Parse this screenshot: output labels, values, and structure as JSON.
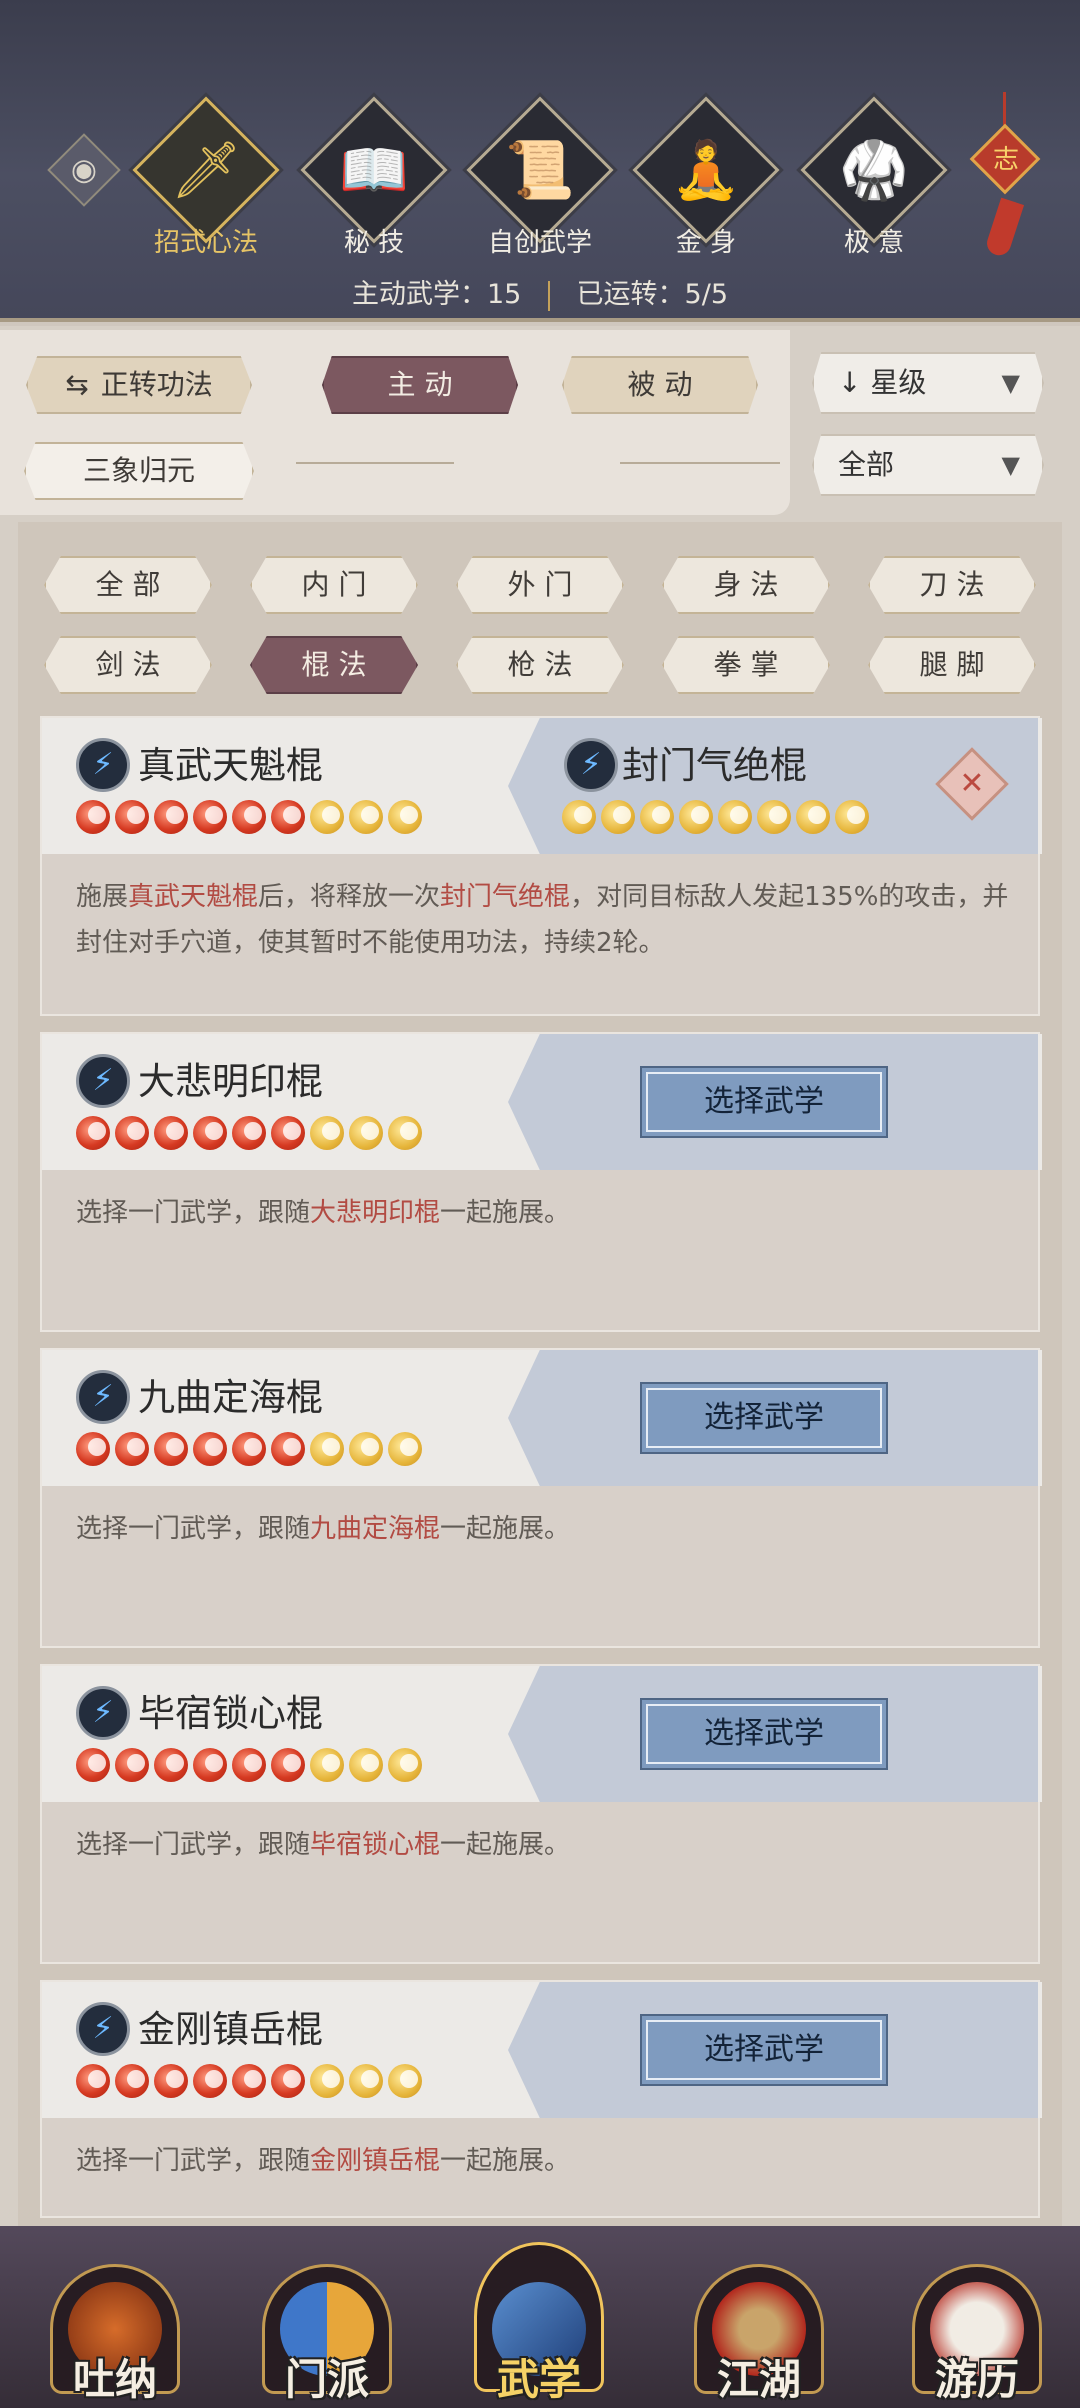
{
  "header": {
    "tabs": [
      {
        "label": "招式心法",
        "glyph": "🗡",
        "icon": "sword-icon",
        "active": true
      },
      {
        "label": "秘 技",
        "glyph": "📖",
        "icon": "book-icon",
        "active": false
      },
      {
        "label": "自创武学",
        "glyph": "📜",
        "icon": "scroll-icon",
        "active": false
      },
      {
        "label": "金 身",
        "glyph": "🧘",
        "icon": "meditation-icon",
        "active": false
      },
      {
        "label": "极 意",
        "glyph": "🥋",
        "icon": "stance-icon",
        "active": false
      }
    ],
    "charm_text": "志",
    "summary_active": "主动武学：15",
    "summary_running": "已运转：5/5"
  },
  "controls": {
    "rotate_label": "正转功法",
    "active_label": "主 动",
    "passive_label": "被 动",
    "sanxiang_label": "三象归元",
    "sort_dropdown": "星级",
    "filter_dropdown": "全部"
  },
  "filters": [
    "全 部",
    "内 门",
    "外 门",
    "身 法",
    "刀 法",
    "剑 法",
    "棍 法",
    "枪 法",
    "拳 掌",
    "腿 脚"
  ],
  "active_filter": "棍 法",
  "cards": [
    {
      "name": "真武天魁棍",
      "stars_red": 6,
      "stars_gold": 3,
      "pair_name": "封门气绝棍",
      "pair_stars_gold": 8,
      "desc_parts": [
        "施展",
        "真武天魁棍",
        "后，将释放一次",
        "封门气绝棍",
        "，对同目标敌人发起135%的攻击，并封住对手穴道，使其暂时不能使用功法，持续2轮。"
      ]
    },
    {
      "name": "大悲明印棍",
      "stars_red": 6,
      "stars_gold": 3,
      "select_label": "选择武学",
      "desc_parts": [
        "选择一门武学，跟随",
        "大悲明印棍",
        "一起施展。"
      ]
    },
    {
      "name": "九曲定海棍",
      "stars_red": 6,
      "stars_gold": 3,
      "select_label": "选择武学",
      "desc_parts": [
        "选择一门武学，跟随",
        "九曲定海棍",
        "一起施展。"
      ]
    },
    {
      "name": "毕宿锁心棍",
      "stars_red": 6,
      "stars_gold": 3,
      "select_label": "选择武学",
      "desc_parts": [
        "选择一门武学，跟随",
        "毕宿锁心棍",
        "一起施展。"
      ]
    },
    {
      "name": "金刚镇岳棍",
      "stars_red": 6,
      "stars_gold": 3,
      "select_label": "选择武学",
      "desc_parts": [
        "选择一门武学，跟随",
        "金刚镇岳棍",
        "一起施展。"
      ]
    }
  ],
  "bottom_nav": [
    {
      "label": "吐纳",
      "icon": "monk-icon",
      "active": false
    },
    {
      "label": "门派",
      "icon": "banner-icon",
      "active": false
    },
    {
      "label": "武学",
      "icon": "manual-icon",
      "active": true
    },
    {
      "label": "江湖",
      "icon": "hat-icon",
      "active": false
    },
    {
      "label": "游历",
      "icon": "horse-icon",
      "active": false
    }
  ]
}
